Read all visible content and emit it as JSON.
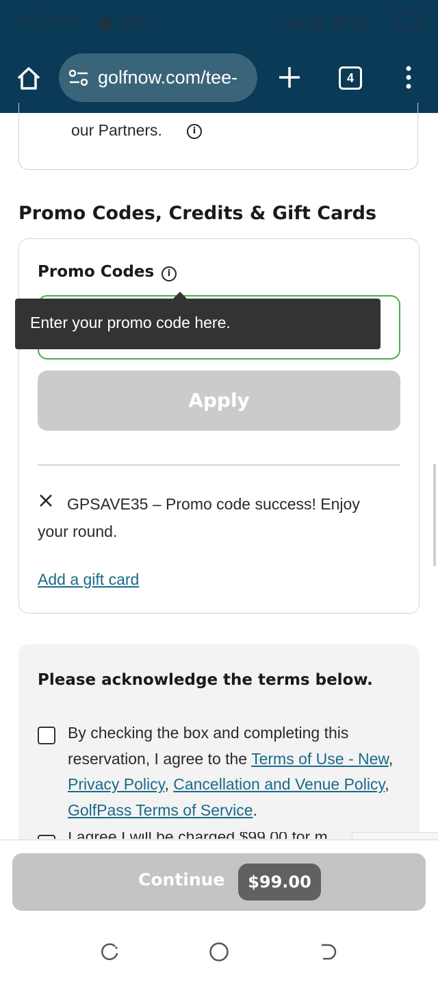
{
  "status_bar": {
    "time": "3:57 P. M.",
    "net_speed": "8.0\nK/s",
    "battery": "56"
  },
  "browser": {
    "url": "golfnow.com/tee-",
    "tab_count": "4"
  },
  "partners": {
    "text": "our Partners."
  },
  "promo_section": {
    "title": "Promo Codes, Credits & Gift Cards",
    "label": "Promo Codes",
    "tooltip": "Enter your promo code here.",
    "apply_label": "Apply",
    "applied_code": "GPSAVE35 – Promo code success! Enjoy your round.",
    "gift_link": "Add a gift card"
  },
  "terms": {
    "title": "Please acknowledge the terms below.",
    "text_before": "By checking the box and completing this reservation, I agree to the ",
    "link_terms": "Terms of Use - New",
    "sep1": ", ",
    "link_privacy": "Privacy Policy",
    "sep2": ", ",
    "link_cancellation": "Cancellation and Venue Policy",
    "sep3": ", ",
    "link_golfpass": "GolfPass Terms of Service",
    "text_after": ".",
    "second_text": "I agree I will be charged $99.00 for m"
  },
  "footer": {
    "continue_label": "Continue",
    "price": "$99.00"
  },
  "colors": {
    "chrome": "#0b3a57",
    "url_bar": "#3a6479",
    "link": "#1a6a8a",
    "input_border": "#4caa4c",
    "tooltip": "#333333"
  }
}
